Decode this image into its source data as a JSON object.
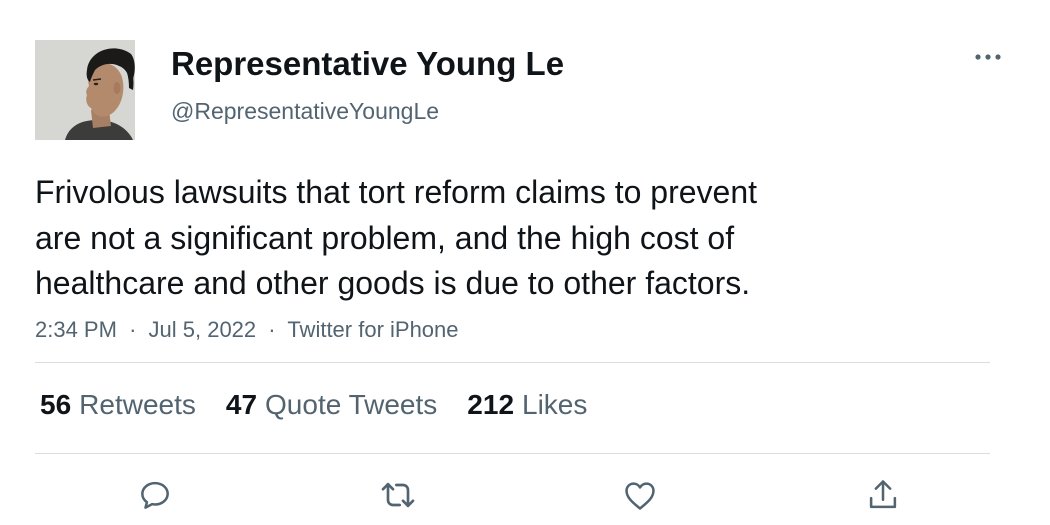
{
  "author": {
    "display_name": "Representative Young Le",
    "handle": "@RepresentativeYoungLe",
    "avatar_icon": "profile-photo"
  },
  "tweet": {
    "text_lines": [
      "Frivolous lawsuits that tort reform claims to prevent",
      "are not a significant problem, and the high cost of",
      "healthcare and other goods is due to other factors."
    ],
    "time": "2:34 PM",
    "date": "Jul 5, 2022",
    "source": "Twitter for iPhone",
    "separator": "·"
  },
  "stats": {
    "retweets_count": "56",
    "retweets_label": "Retweets",
    "quotes_count": "47",
    "quotes_label": "Quote Tweets",
    "likes_count": "212",
    "likes_label": "Likes"
  },
  "actions": {
    "reply_icon": "reply-icon",
    "retweet_icon": "retweet-icon",
    "like_icon": "heart-icon",
    "share_icon": "share-icon"
  },
  "colors": {
    "text_primary": "#0f1419",
    "text_secondary": "#536471",
    "divider": "#d9dde0"
  }
}
